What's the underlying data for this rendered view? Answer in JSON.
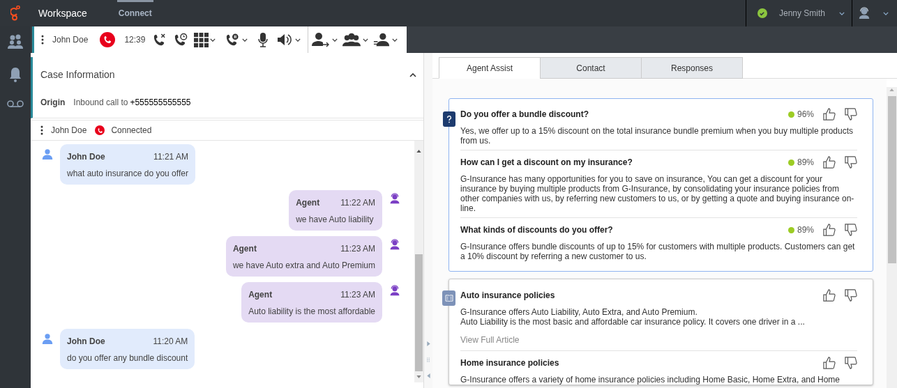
{
  "top_bar": {
    "app_name": "Workspace",
    "tabs": [
      {
        "label": "Connect",
        "selected": true
      }
    ],
    "user": {
      "name": "Jenny Smith",
      "available": true
    }
  },
  "call_toolbar": {
    "contact": "John Doe",
    "timer": "12:39"
  },
  "case_information": {
    "title": "Case Information",
    "expanded": true,
    "fields": [
      {
        "label": "Origin",
        "value": "Inbound call to",
        "phone": "+555555555555"
      }
    ]
  },
  "interaction_bar": {
    "contact": "John Doe",
    "status": "Connected"
  },
  "chat": {
    "messages": [
      {
        "kind": "customer",
        "sender": "John Doe",
        "time": "11:21 AM",
        "text": "what auto insurance do you offer"
      },
      {
        "kind": "agent",
        "sender": "Agent",
        "time": "11:22 AM",
        "text": "we have Auto liability"
      },
      {
        "kind": "agent",
        "sender": "Agent",
        "time": "11:23 AM",
        "text": "we have Auto extra and Auto Premium"
      },
      {
        "kind": "agent",
        "sender": "Agent",
        "time": "11:23 AM",
        "text": "Auto liability is the most affordable"
      },
      {
        "kind": "customer",
        "sender": "John Doe",
        "time": "11:20 AM",
        "text": "do you offer any bundle discount"
      }
    ]
  },
  "assist_panel": {
    "tabs": [
      {
        "label": "Agent Assist",
        "selected": true
      },
      {
        "label": "Contact",
        "selected": false
      },
      {
        "label": "Responses",
        "selected": false
      }
    ],
    "cards": [
      {
        "kind": "faq",
        "highlighted": true,
        "items": [
          {
            "title": "Do you offer a bundle discount?",
            "score": "96%",
            "text": "Yes, we offer up to a 15% discount on the total insurance bundle premium when you buy multiple products from us."
          },
          {
            "title": "How can I get a discount on my insurance?",
            "score": "89%",
            "text": "G-Insurance has many opportunities for you to save on insurance, You can get a discount for your insurance by buying multiple products from G-Insurance, by consolidating your insurance policies from other companies with us, by referring new customers to us, or by getting a quote and buying insurance on-line."
          },
          {
            "title": "What kinds of discounts do you offer?",
            "score": "89%",
            "text": "G-Insurance offers bundle discounts of up to 15% for customers with multiple products. Customers can get a 10% discount by referring a new customer to us."
          }
        ]
      },
      {
        "kind": "article",
        "highlighted": false,
        "items": [
          {
            "title": "Auto insurance policies",
            "text": "G-Insurance offers Auto Liability, Auto Extra, and Auto Premium.\nAuto Liability is the most basic and affordable car insurance policy. It covers one driver in a ...",
            "link": "View Full Article"
          },
          {
            "title": "Home insurance policies",
            "text": "G-Insurance offers a variety of home insurance policies including Home Basic, Home Extra, and Home"
          }
        ]
      }
    ]
  }
}
